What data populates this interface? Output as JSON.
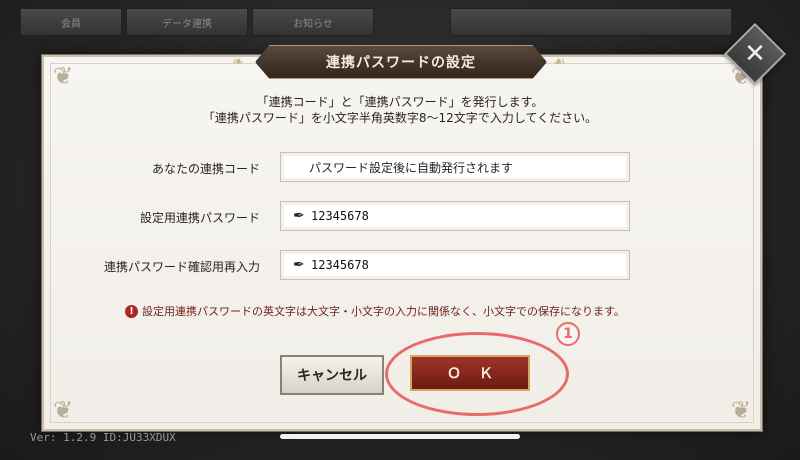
{
  "background": {
    "tabs": [
      "会員",
      "データ連携",
      "お知らせ"
    ]
  },
  "dialog": {
    "title": "連携パスワードの設定",
    "close_icon": "close-icon",
    "instructions": [
      "「連携コード」と「連携パスワード」を発行します。",
      "「連携パスワード」を小文字半角英数字8〜12文字で入力してください。"
    ],
    "fields": [
      {
        "label": "あなたの連携コード",
        "value": "パスワード設定後に自動発行されます"
      },
      {
        "label": "設定用連携パスワード",
        "value": "12345678",
        "icon": "quill-pen-icon"
      },
      {
        "label": "連携パスワード確認用再入力",
        "value": "12345678",
        "icon": "quill-pen-icon"
      }
    ],
    "warning": {
      "icon": "exclamation-icon",
      "text": "設定用連携パスワードの英文字は大文字・小文字の入力に関係なく、小文字での保存になります。"
    },
    "buttons": {
      "cancel": "キャンセル",
      "ok": "ＯＫ"
    },
    "callout_number": "1"
  },
  "footer": {
    "version": "Ver: 1.2.9  ID:JU33XDUX"
  },
  "colors": {
    "accent_red": "#a03326",
    "callout_pink": "#e86b6b",
    "panel_bg": "#f7f5f1",
    "title_plate": "#3f3228"
  }
}
